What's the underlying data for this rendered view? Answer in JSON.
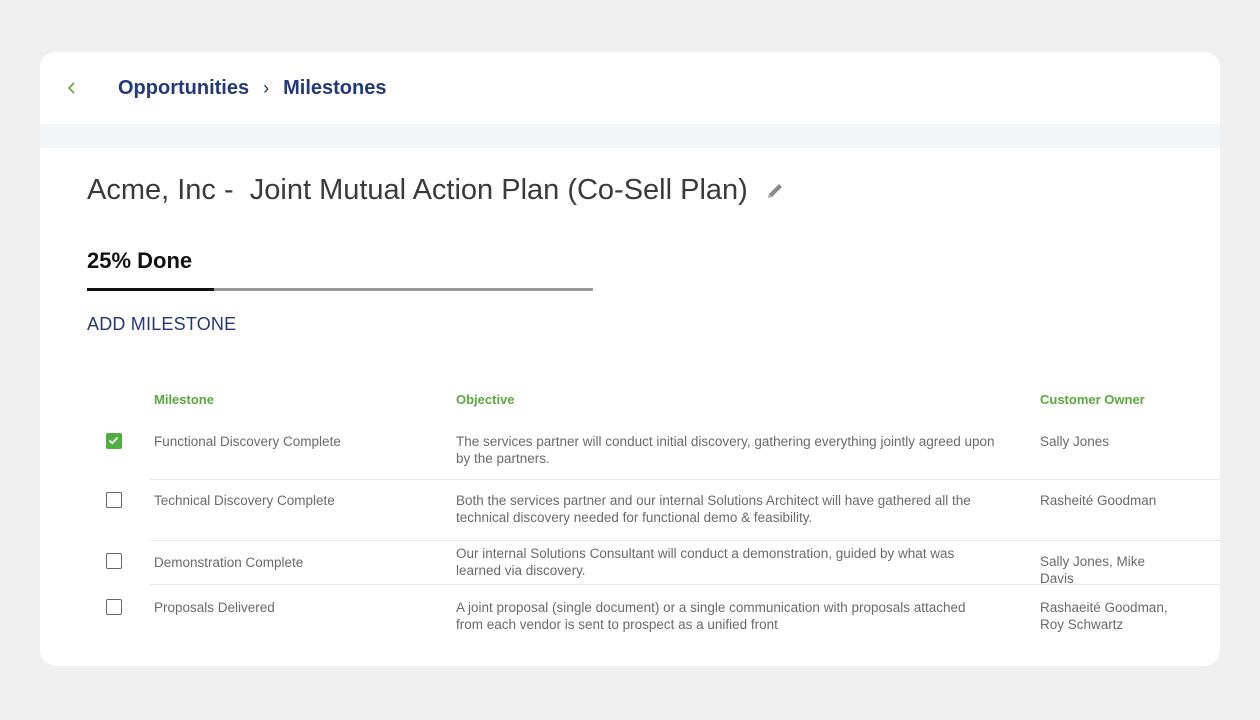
{
  "breadcrumb": {
    "back_icon": "chevron-left-icon",
    "items": [
      "Opportunities",
      "Milestones"
    ],
    "separator": "›"
  },
  "plan": {
    "title": "Acme, Inc -  Joint Mutual Action Plan (Co-Sell Plan)",
    "edit_icon": "pencil-icon",
    "progress_label": "25% Done",
    "progress_fraction": 0.25,
    "add_label": "ADD MILESTONE"
  },
  "table": {
    "headers": {
      "milestone": "Milestone",
      "objective": "Objective",
      "owner": "Customer Owner"
    },
    "rows": [
      {
        "checked": true,
        "milestone": "Functional Discovery Complete",
        "objective": "The services partner will conduct initial discovery, gathering everything jointly agreed upon by the partners.",
        "owner": "Sally Jones"
      },
      {
        "checked": false,
        "milestone": "Technical Discovery Complete",
        "objective": "Both the services partner and our internal Solutions Architect will have gathered all the technical discovery needed for functional demo & feasibility.",
        "owner": "Rasheité Goodman"
      },
      {
        "checked": false,
        "milestone": "Demonstration Complete",
        "objective": "Our internal Solutions Consultant will conduct a demonstration, guided by what was learned via discovery.",
        "owner": "Sally Jones, Mike Davis"
      },
      {
        "checked": false,
        "milestone": "Proposals Delivered",
        "objective": "A joint proposal (single document) or a single communication with proposals attached from each vendor is sent to prospect as a unified front",
        "owner": "Rashaeité Goodman, Roy Schwartz"
      }
    ]
  },
  "colors": {
    "accent_green": "#5aa83c",
    "navy": "#233a7a",
    "checkbox_checked": "#4fae3f"
  }
}
